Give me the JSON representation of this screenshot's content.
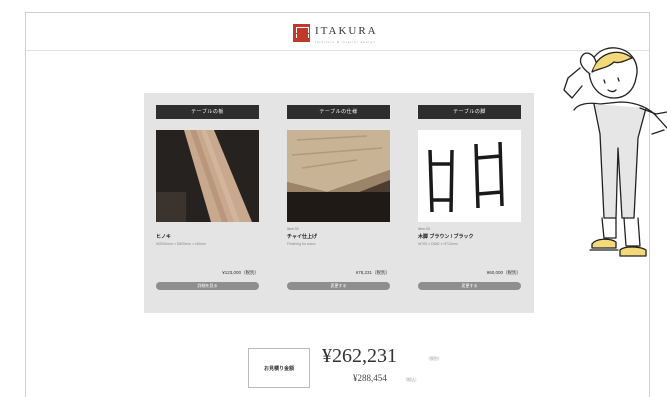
{
  "header": {
    "brand": "ITAKURA",
    "tagline": "furniture & interior design"
  },
  "products": [
    {
      "category": "テーブルの板",
      "code": "",
      "name": "ヒノキ",
      "desc": "W2000mm × D800mm × t40mm",
      "price": "¥123,000（税別）",
      "button": "詳細を見る"
    },
    {
      "category": "テーブルの仕様",
      "code": "Item 02",
      "name": "チャイ仕上げ",
      "desc": "Finishing for wood",
      "price": "¥78,231（税別）",
      "button": "変更する"
    },
    {
      "category": "テーブルの脚",
      "code": "Item 03",
      "name": "木脚 ブラウン / ブラック",
      "desc": "W700 × D650 × H710mm",
      "price": "¥60,000（税別）",
      "button": "変更する"
    }
  ],
  "total": {
    "label": "お見積り金額",
    "amount": "¥262,231",
    "amount_tax": "（税別）",
    "amount_incl": "¥288,454",
    "amount_incl_tax": "（税込）"
  }
}
